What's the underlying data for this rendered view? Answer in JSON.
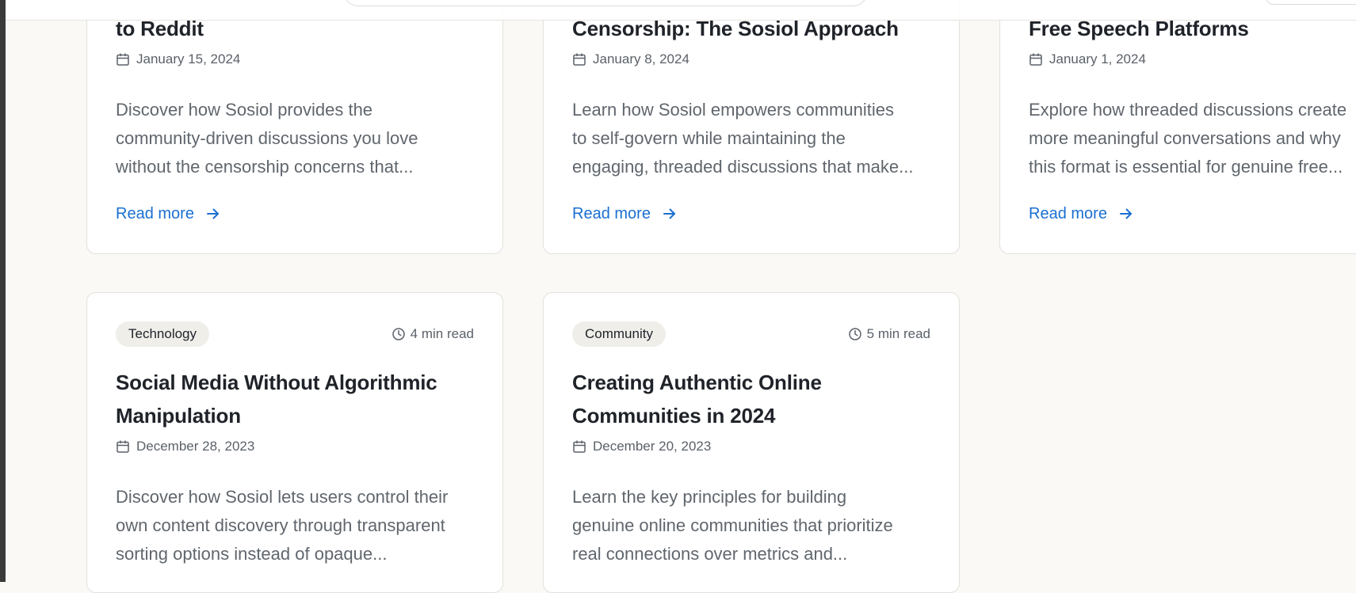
{
  "posts": [
    {
      "title": "to Reddit",
      "date": "January 15, 2024",
      "excerpt_lines": [
        "Discover how Sosiol provides the",
        "community-driven discussions you love",
        "without the censorship concerns that..."
      ],
      "read_more": "Read more"
    },
    {
      "title": "Censorship: The Sosiol Approach",
      "date": "January 8, 2024",
      "excerpt_lines": [
        "Learn how Sosiol empowers communities",
        "to self-govern while maintaining the",
        "engaging, threaded discussions that make..."
      ],
      "read_more": "Read more"
    },
    {
      "title": "Free Speech Platforms",
      "date": "January 1, 2024",
      "excerpt_lines": [
        "Explore how threaded discussions create",
        "more meaningful conversations and why",
        "this format is essential for genuine free..."
      ],
      "read_more": "Read more"
    },
    {
      "tag": "Technology",
      "read_time": "4 min read",
      "title_lines": [
        "Social Media Without Algorithmic",
        "Manipulation"
      ],
      "date": "December 28, 2023",
      "excerpt_lines": [
        "Discover how Sosiol lets users control their",
        "own content discovery through transparent",
        "sorting options instead of opaque..."
      ]
    },
    {
      "tag": "Community",
      "read_time": "5 min read",
      "title_lines": [
        "Creating Authentic Online",
        "Communities in 2024"
      ],
      "date": "December 20, 2023",
      "excerpt_lines": [
        "Learn the key principles for building",
        "genuine online communities that prioritize",
        "real connections over metrics and..."
      ]
    }
  ],
  "colors": {
    "page_background": "#faf9f6",
    "card_background": "#ffffff",
    "link": "#1a6fd1",
    "tag_background": "#efeee9",
    "muted_text": "#5b6169"
  },
  "icons": [
    "calendar-icon",
    "clock-icon",
    "arrow-right-icon"
  ]
}
